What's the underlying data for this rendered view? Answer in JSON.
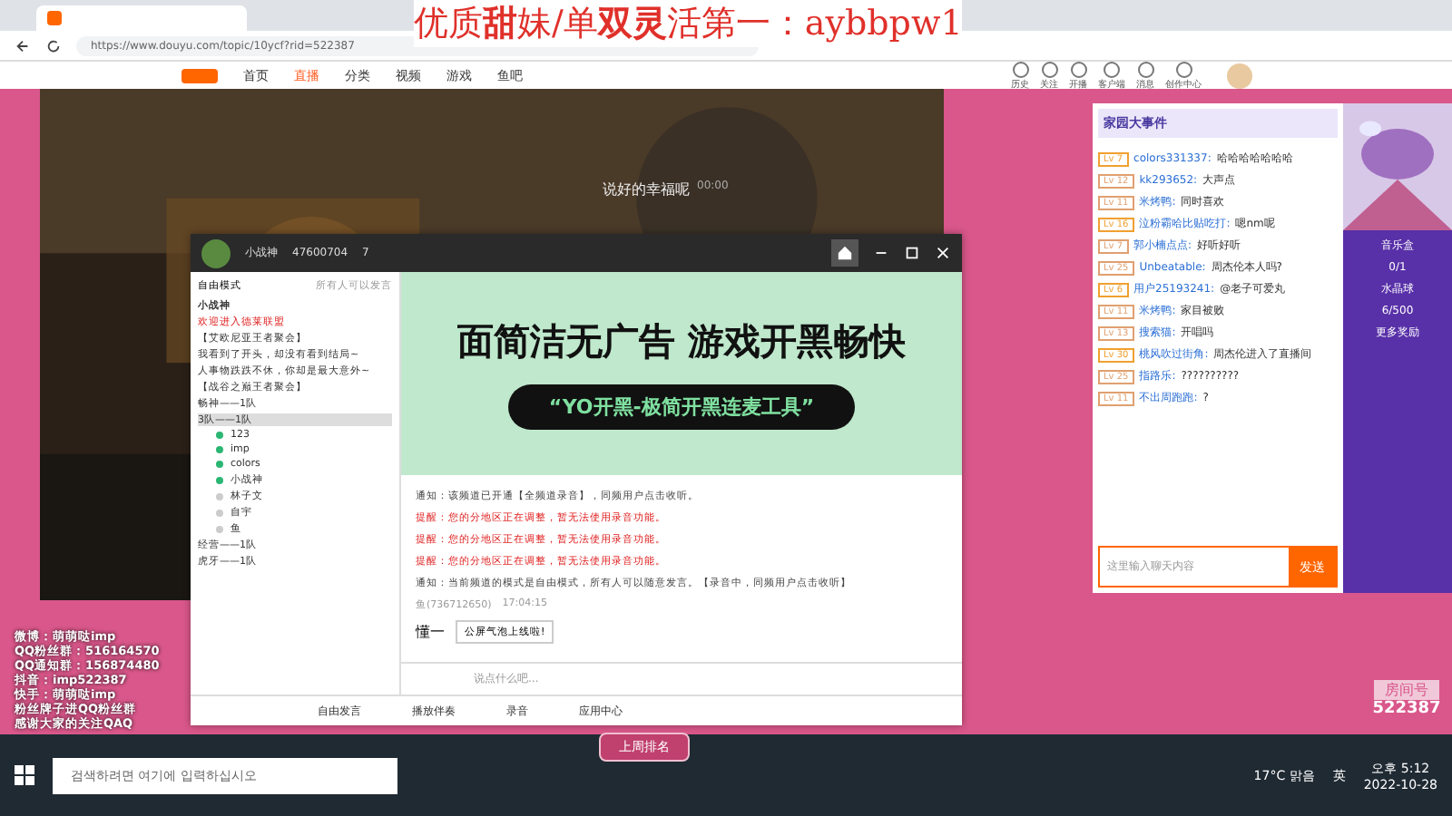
{
  "browser": {
    "url": "https://www.douyu.com/topic/10ycf?rid=522387"
  },
  "overlay_title": "优质**甜**妹/单**双灵**活第一：aybbpw1",
  "site_nav": [
    {
      "label": "首页",
      "selected": false
    },
    {
      "label": "直播",
      "selected": true
    },
    {
      "label": "分类",
      "selected": false
    },
    {
      "label": "视频",
      "selected": false
    },
    {
      "label": "游戏",
      "selected": false
    },
    {
      "label": "鱼吧",
      "selected": false
    }
  ],
  "header_links": [
    "历史",
    "关注",
    "开播",
    "客户端",
    "消息",
    "创作中心"
  ],
  "player": {
    "song": "说好的幸福呢",
    "time": "00:00"
  },
  "chat": {
    "event_title": "家园大事件",
    "messages": [
      {
        "badge": "Lv 7",
        "user": "colors331337:",
        "text": "哈哈哈哈哈哈哈"
      },
      {
        "badge": "Lv 12",
        "user": "kk293652:",
        "text": "大声点"
      },
      {
        "badge": "Lv 11",
        "user": "米烤鸭:",
        "text": "同时喜欢"
      },
      {
        "badge": "Lv 16",
        "user": "泣粉霸哈比贴吃打:",
        "text": "嗯nm呢"
      },
      {
        "badge": "Lv 7",
        "user": "郭小楠点点:",
        "text": "好听好听"
      },
      {
        "badge": "Lv 25",
        "user": "Unbeatable:",
        "text": "周杰伦本人吗?"
      },
      {
        "badge": "Lv 6",
        "user": "用户25193241:",
        "text": "@老子可爱丸"
      },
      {
        "badge": "Lv 11",
        "user": "米烤鸭:",
        "text": "家目被败"
      },
      {
        "badge": "Lv 13",
        "user": "搜索猫:",
        "text": "开唱吗"
      },
      {
        "badge": "Lv 30",
        "user": "桃风吹过街角:",
        "text": "周杰伦进入了直播间"
      },
      {
        "badge": "Lv 25",
        "user": "指路乐:",
        "text": "??????????"
      },
      {
        "badge": "Lv 11",
        "user": "不出周跑跑:",
        "text": "?"
      }
    ],
    "input_placeholder": "这里输入聊天内容",
    "send": "发送"
  },
  "sidebar": {
    "items": [
      "音乐盒",
      "0/1",
      "水晶球",
      "6/500",
      "更多奖励"
    ]
  },
  "ranking_button": "上周排名",
  "room": {
    "label": "房间号",
    "number": "522387"
  },
  "yy": {
    "name": "小战神",
    "id": "47600704",
    "count": "7",
    "mode": "自由模式",
    "mode_hint": "所有人可以发言",
    "tree": [
      {
        "label": "小战神",
        "kind": "title",
        "selected": false
      },
      {
        "label": "欢迎进入德莱联盟",
        "kind": "welcome",
        "selected": false
      },
      {
        "label": "【艾欧尼亚王者聚会】",
        "kind": "text",
        "selected": false
      },
      {
        "label": "我看到了开头，却没有看到结局~",
        "kind": "text",
        "selected": false
      },
      {
        "label": "人事物跌跌不休，你却是最大意外~",
        "kind": "text",
        "selected": false
      },
      {
        "label": "【战谷之巅王者聚会】",
        "kind": "text",
        "selected": false
      },
      {
        "label": "畅神——1队",
        "kind": "text",
        "selected": false
      },
      {
        "label": "3队——1队",
        "kind": "text",
        "selected": true,
        "children": [
          {
            "label": "123",
            "online": true
          },
          {
            "label": "imp",
            "online": true
          },
          {
            "label": "colors",
            "online": true
          },
          {
            "label": "小战神",
            "online": true
          },
          {
            "label": "林子文",
            "online": false
          },
          {
            "label": "自宇",
            "online": false
          },
          {
            "label": "鱼",
            "online": false
          }
        ]
      },
      {
        "label": "经营——1队",
        "kind": "text",
        "selected": false
      },
      {
        "label": "虎牙——1队",
        "kind": "text",
        "selected": false
      }
    ],
    "banner": {
      "headline": "面简洁无广告  游戏开黑畅快",
      "slogan": "“YO开黑-极简开黑连麦工具”"
    },
    "notices": [
      {
        "kind": "notice",
        "text": "通知：该频道已开通【全频道录音】，同频用户点击收听。"
      },
      {
        "kind": "alert",
        "text": "提醒：您的分地区正在调整，暂无法使用录音功能。"
      },
      {
        "kind": "alert",
        "text": "提醒：您的分地区正在调整，暂无法使用录音功能。"
      },
      {
        "kind": "alert",
        "text": "提醒：您的分地区正在调整，暂无法使用录音功能。"
      },
      {
        "kind": "notice",
        "text": "通知：当前频道的模式是自由模式，所有人可以随意发言。【录音中，同频用户点击收听】"
      }
    ],
    "last_message": {
      "sender": "鱼(736712650)",
      "time": "17:04:15",
      "text": "懂一"
    },
    "tooltip": "公屏气泡上线啦!",
    "input_placeholder": "说点什么吧...",
    "bottom": [
      "自由发言",
      "播放伴奏",
      "录音",
      "应用中心"
    ]
  },
  "stream_info": [
    "微博：萌萌哒imp",
    "QQ粉丝群：516164570",
    "QQ通知群：156874480",
    "抖音：imp522387",
    "快手：萌萌哒imp",
    "粉丝牌子进QQ粉丝群",
    "感谢大家的关注QAQ"
  ],
  "taskbar": {
    "search_placeholder": "검색하려면 여기에 입력하십시오",
    "weather": "17°C  맑음",
    "ime": "英",
    "time": "오후 5:12",
    "date": "2022-10-28"
  }
}
